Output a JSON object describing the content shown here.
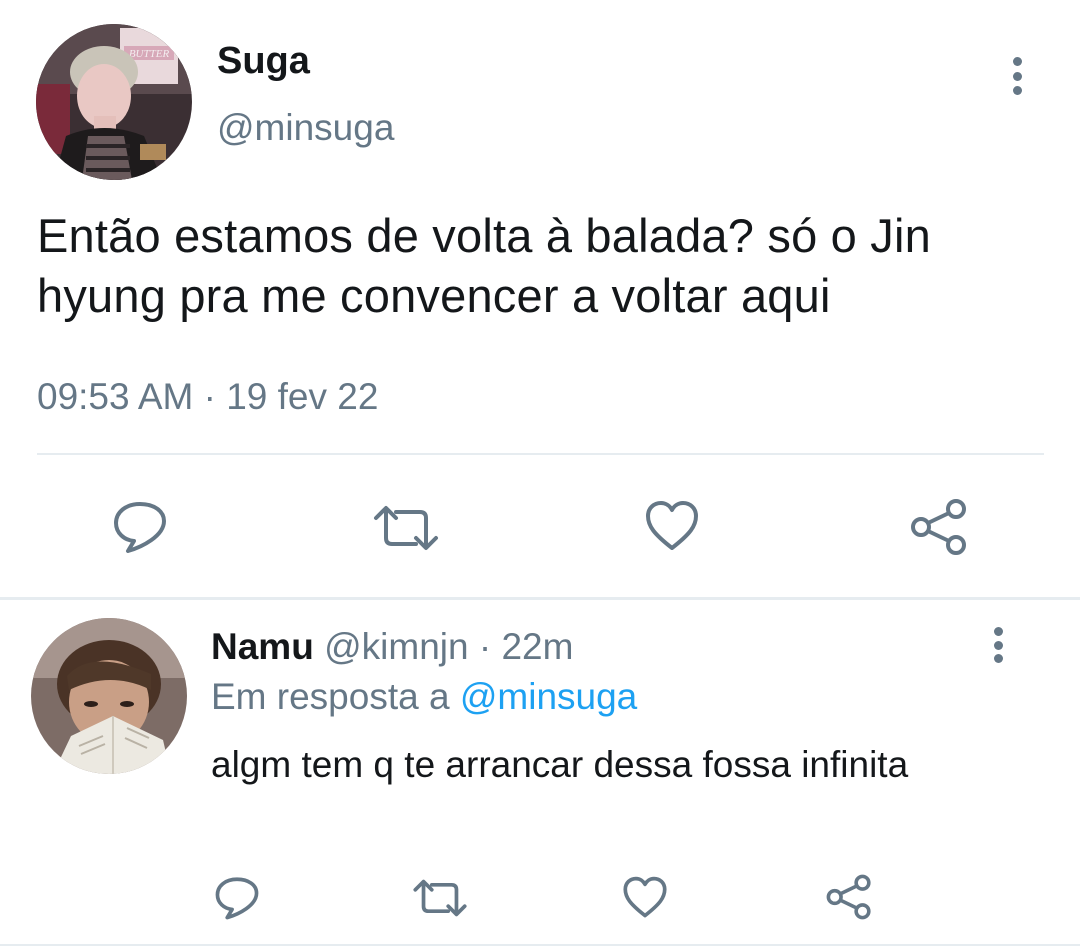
{
  "main_tweet": {
    "author_name": "Suga",
    "handle": "@minsuga",
    "text": "Então estamos de volta à balada? só o Jin hyung pra me convencer a voltar aqui",
    "timestamp": "09:53 AM · 19 fev 22",
    "actions": [
      "reply-icon",
      "retweet-icon",
      "like-icon",
      "share-icon"
    ],
    "avatar_sign_text": "BUTTER"
  },
  "reply": {
    "author_name": "Namu",
    "handle": "@kimnjn",
    "separator": " · ",
    "time": "22m",
    "in_reply_prefix": "Em resposta a ",
    "in_reply_handle": "@minsuga",
    "text": "algm tem q te arrancar dessa fossa infinita",
    "actions": [
      "reply-icon",
      "retweet-icon",
      "like-icon",
      "share-icon"
    ]
  },
  "colors": {
    "text": "#14171a",
    "muted": "#657786",
    "link": "#1da1f2",
    "divider": "#e6ecf0"
  }
}
